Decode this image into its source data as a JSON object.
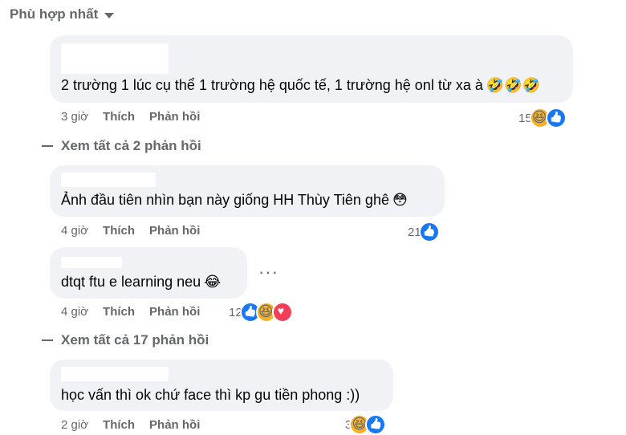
{
  "sort": {
    "label": "Phù hợp nhất"
  },
  "comments": [
    {
      "text": "2 trường 1 lúc cụ thể 1 trường hệ quốc tế, 1 trường hệ onl từ xa à",
      "emoji": "🤣🤣🤣",
      "time": "3 giờ",
      "like": "Thích",
      "reply": "Phản hồi",
      "reaction_count": "15",
      "reactions": [
        "haha",
        "like"
      ]
    },
    {
      "text": "Ảnh đầu tiên nhìn bạn này giống HH Thùy Tiên ghê",
      "emoji": "😳",
      "time": "4 giờ",
      "like": "Thích",
      "reply": "Phản hồi",
      "reaction_count": "21",
      "reactions": [
        "like"
      ]
    },
    {
      "text": "dtqt ftu e learning neu",
      "emoji": "😂",
      "time": "4 giờ",
      "like": "Thích",
      "reply": "Phản hồi",
      "reaction_count": "12",
      "reactions": [
        "like",
        "haha",
        "love"
      ],
      "more": "···"
    },
    {
      "text": "học vấn thì ok chứ face thì kp gu tiền phong :))",
      "emoji": "",
      "time": "2 giờ",
      "like": "Thích",
      "reply": "Phản hồi",
      "reaction_count": "3",
      "reactions": [
        "haha",
        "like"
      ]
    }
  ],
  "view_replies": [
    {
      "label": "Xem tất cả 2 phản hồi"
    },
    {
      "label": "Xem tất cả 17 phản hồi"
    }
  ]
}
